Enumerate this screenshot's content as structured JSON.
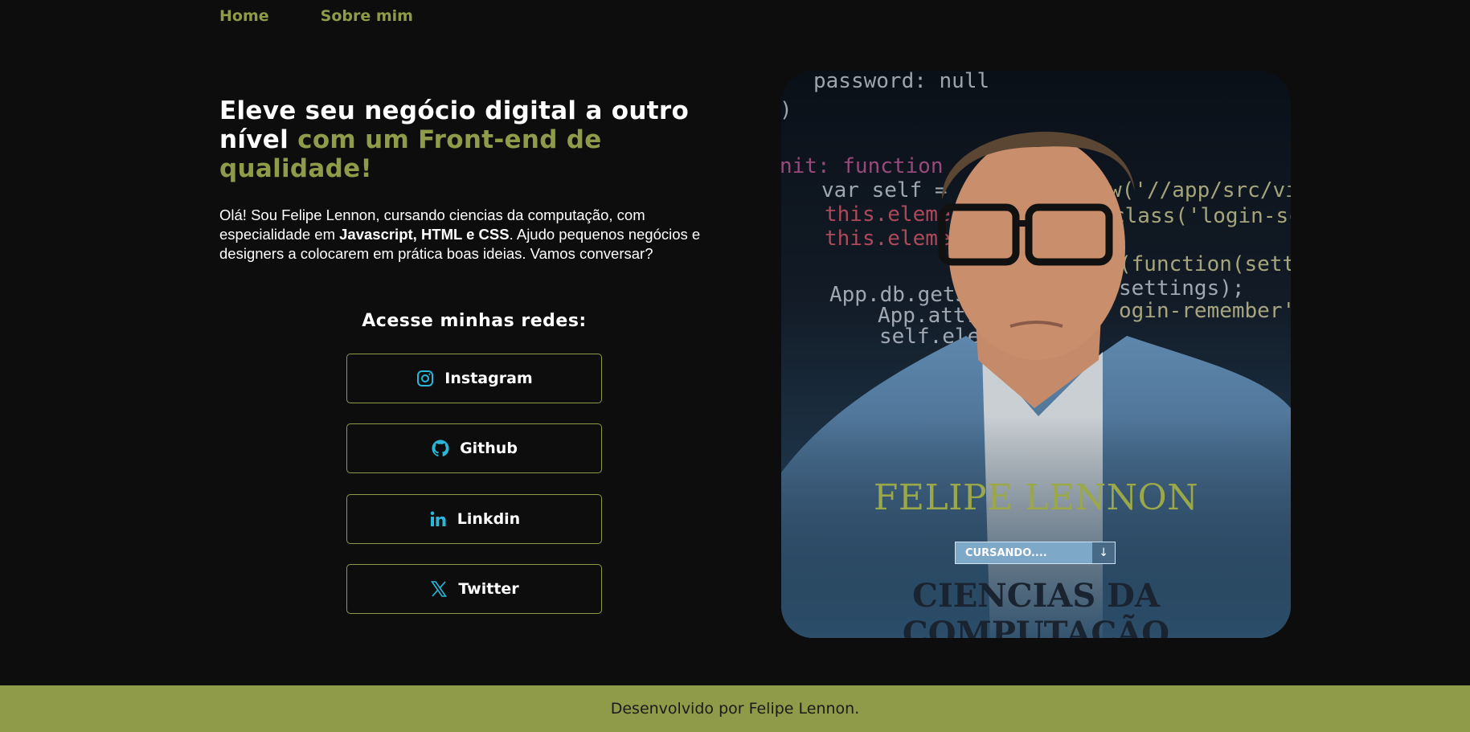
{
  "nav": {
    "items": [
      "Home",
      "Sobre mim"
    ]
  },
  "hero": {
    "headline_part1": "Eleve seu negócio digital a outro nível ",
    "headline_accent": "com um Front-end de qualidade!",
    "intro_before": "Olá! Sou Felipe Lennon, cursando ciencias da computação, com especialidade em ",
    "intro_bold": "Javascript, HTML e CSS",
    "intro_after": ". Ajudo pequenos negócios e designers a colocarem em prática boas ideias. Vamos conversar?"
  },
  "socials": {
    "title": "Acesse minhas redes:",
    "buttons": [
      {
        "label": "Instagram",
        "icon": "instagram-icon"
      },
      {
        "label": "Github",
        "icon": "github-icon"
      },
      {
        "label": "Linkdin",
        "icon": "linkedin-icon"
      },
      {
        "label": "Twitter",
        "icon": "x-twitter-icon"
      }
    ]
  },
  "card": {
    "code_lines": [
      "password: null",
      ")",
      "nit: function",
      "var self =",
      "this.eleme",
      "this.eleme",
      "App.db.getS",
      "App.attr",
      "self.ele",
      "w('//app/src/vie",
      "class('login-scr",
      "(function(settin",
      "settings);",
      "ogin-remember')."
    ],
    "name": "FELIPE LENNON",
    "badge": "CURSANDO....",
    "badge_arrow": "↓",
    "course": "CIENCIAS DA COMPUTAÇÃO"
  },
  "footer": {
    "text": "Desenvolvido por Felipe Lennon."
  },
  "colors": {
    "accent": "#8f9b48",
    "background": "#0d0d0d",
    "icon": "#29b6d8"
  }
}
